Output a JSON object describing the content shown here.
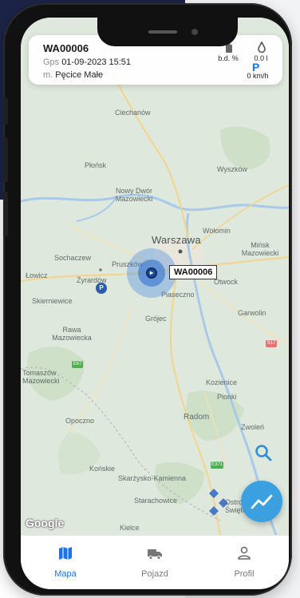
{
  "vehicle": {
    "plate": "WA00006",
    "gps_label": "Gps",
    "gps_datetime": "01-09-2023 15:51",
    "location_label": "m.",
    "location": "Pęcice Małe"
  },
  "status": {
    "battery": "b.d. %",
    "fuel": "0.0 l",
    "parking": "P",
    "speed": "0 km/h"
  },
  "map": {
    "marker_label": "WA00006",
    "poi_marker": "P",
    "attribution": "Google",
    "places": {
      "ciechanow": "Ciechanów",
      "plonsk": "Płońsk",
      "wyszkow": "Wyszków",
      "nowy_dwor": "Nowy Dwór Mazowiecki",
      "wolomin": "Wołomin",
      "warszawa": "Warszawa",
      "minsk": "Mińsk Mazowiecki",
      "sochaczew": "Sochaczew",
      "pruszkow": "Pruszków",
      "lowicz": "Łowicz",
      "zyrardow": "Żyrardów",
      "otwock": "Otwock",
      "skierniewice": "Skierniewice",
      "piaseczno": "Piaseczno",
      "garwolin": "Garwolin",
      "grojec": "Grójec",
      "rawa": "Rawa Mazowiecka",
      "tomaszow": "Tomaszów Mazowiecki",
      "kozienice": "Kozienice",
      "pionki": "Pionki",
      "opoczno": "Opoczno",
      "radom": "Radom",
      "zwolen": "Zwoleń",
      "konskie": "Końskie",
      "skarzysko": "Skarżysko-Kamienna",
      "starachowice": "Starachowice",
      "ostrowiec": "Ostrowiec Świętokrzyski",
      "kielce": "Kielce"
    },
    "roads": [
      "E67",
      "S17",
      "E371"
    ]
  },
  "nav": {
    "items": [
      {
        "label": "Mapa",
        "active": true
      },
      {
        "label": "Pojazd",
        "active": false
      },
      {
        "label": "Profil",
        "active": false
      }
    ]
  },
  "colors": {
    "accent": "#1a73e8",
    "fab": "#3aa0e0",
    "map_land": "#dfe8dd",
    "map_water": "#a9c9e8"
  }
}
